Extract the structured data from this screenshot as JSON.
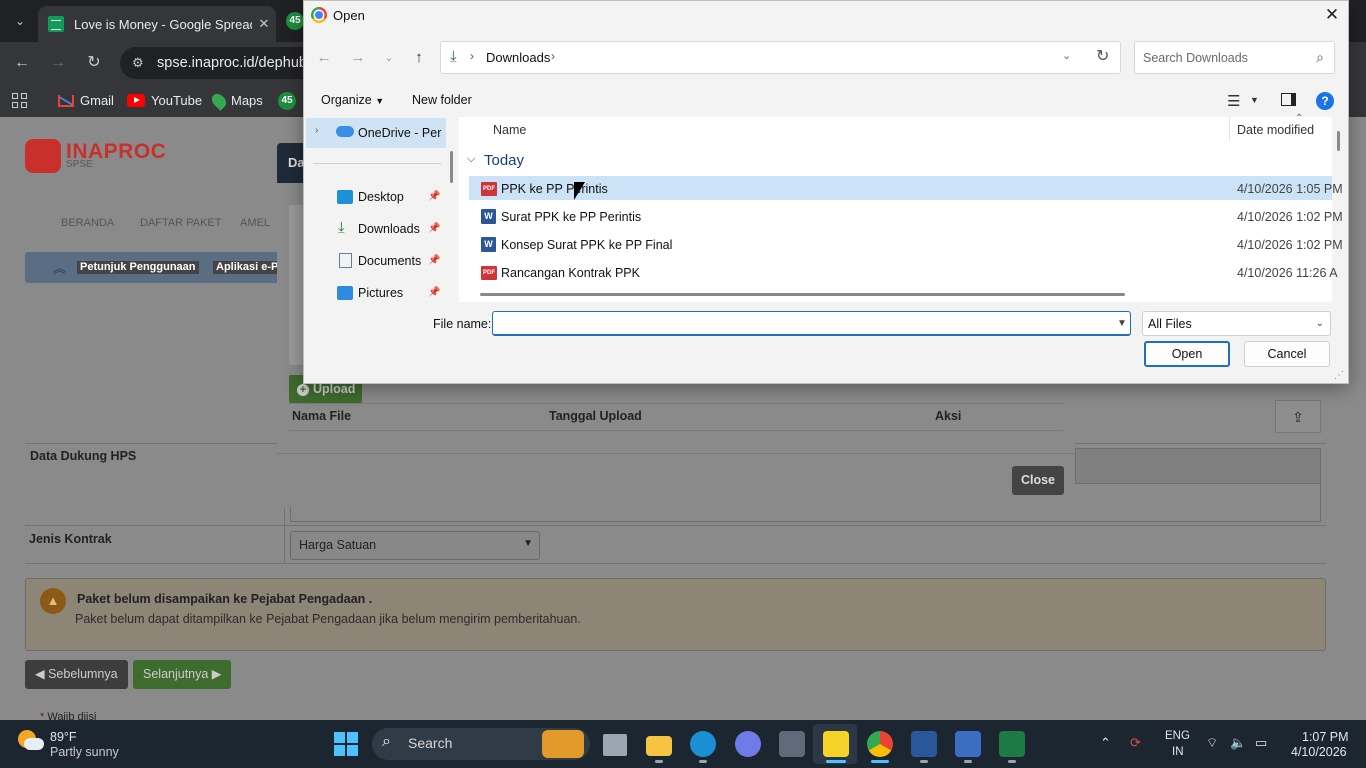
{
  "browser": {
    "tab_title": "Love is Money - Google Spread",
    "tab_close": "✕",
    "tab2_badge": "45",
    "url": "spse.inaproc.id/dephub",
    "bookmarks": [
      {
        "label": "Gmail",
        "icon": "gmail-icon"
      },
      {
        "label": "YouTube",
        "icon": "youtube-icon"
      },
      {
        "label": "Maps",
        "icon": "maps-icon"
      },
      {
        "label": "45",
        "icon": "badge-icon"
      }
    ]
  },
  "page": {
    "logo_text": "INAPROC",
    "logo_sub": "SPSE",
    "nav": [
      "BERANDA",
      "DAFTAR PAKET",
      "AMEL"
    ],
    "quick_buttons": [
      "Petunjuk Penggunaan",
      "Aplikasi e-Pr"
    ],
    "row_hps_label": "Data Dukung HPS",
    "row_kontrak_label": "Jenis Kontrak",
    "kontrak_value": "Harga Satuan",
    "warning_title": "Paket belum disampaikan ke Pejabat Pengadaan .",
    "warning_desc": "Paket belum dapat ditampilkan ke Pejabat Pengadaan jika belum mengirim pemberitahuan.",
    "prev_button": "Sebelumnya",
    "next_button": "Selanjutnya",
    "required_note": "Wajib diisi",
    "required_star": "*"
  },
  "modal": {
    "title": "Da",
    "upload_button": "Upload",
    "columns": [
      "Nama File",
      "Tanggal Upload",
      "Aksi"
    ],
    "close_button": "Close"
  },
  "dialog": {
    "title": "Open",
    "breadcrumb": "Downloads",
    "search_placeholder": "Search Downloads",
    "organize": "Organize",
    "new_folder": "New folder",
    "nav_items": [
      {
        "label": "OneDrive - Perso",
        "icon": "onedrive-icon"
      },
      {
        "label": "Desktop",
        "icon": "desktop-icon"
      },
      {
        "label": "Downloads",
        "icon": "download-icon"
      },
      {
        "label": "Documents",
        "icon": "documents-icon"
      },
      {
        "label": "Pictures",
        "icon": "pictures-icon"
      }
    ],
    "col_name": "Name",
    "col_date": "Date modified",
    "group": "Today",
    "files": [
      {
        "name": "PPK ke PP Perintis",
        "type": "pdf",
        "date": "4/10/2026 1:05 PM",
        "selected": true
      },
      {
        "name": "Surat PPK ke PP Perintis",
        "type": "docx",
        "date": "4/10/2026 1:02 PM",
        "selected": false
      },
      {
        "name": "Konsep Surat PPK ke PP Final",
        "type": "docx",
        "date": "4/10/2026 1:02 PM",
        "selected": false
      },
      {
        "name": "Rancangan Kontrak PPK",
        "type": "pdf",
        "date": "4/10/2026 11:26 A",
        "selected": false
      }
    ],
    "file_name_label": "File name:",
    "file_name_value": "",
    "file_type": "All Files",
    "open_button": "Open",
    "cancel_button": "Cancel"
  },
  "taskbar": {
    "temperature": "89°F",
    "weather": "Partly sunny",
    "search": "Search",
    "apps": [
      "file-explorer-icon",
      "files-icon",
      "edge-icon",
      "copilot-icon",
      "camera-icon",
      "sticky-notes-icon",
      "chrome-icon",
      "word-icon",
      "calculator-icon",
      "excel-icon"
    ],
    "lang": "ENG",
    "region": "IN",
    "time": "1:07 PM",
    "date": "4/10/2026"
  }
}
